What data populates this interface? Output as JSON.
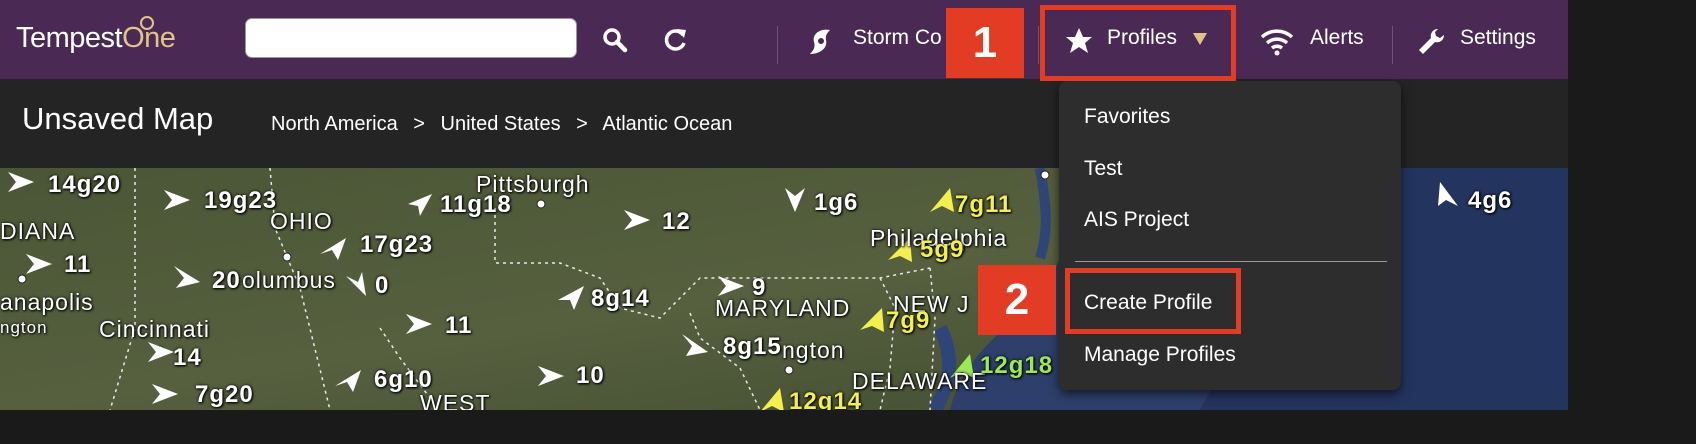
{
  "app": {
    "logo_main": "Tempest",
    "logo_accent": "One"
  },
  "search": {
    "value": "",
    "placeholder": ""
  },
  "toolbar": {
    "search_icon": "search-icon",
    "refresh_icon": "refresh-icon"
  },
  "nav": {
    "storm_label": "Storm Co",
    "profiles_label": "Profiles",
    "alerts_label": "Alerts",
    "settings_label": "Settings"
  },
  "callouts": {
    "one": "1",
    "two": "2"
  },
  "subheader": {
    "title": "Unsaved Map",
    "breadcrumb": [
      "North America",
      ">",
      "United States",
      ">",
      "Atlantic Ocean"
    ]
  },
  "profiles_menu": {
    "items": [
      "Favorites",
      "Test",
      "AIS Project"
    ],
    "actions": [
      "Create Profile",
      "Manage Profiles"
    ]
  },
  "map": {
    "wind_labels": [
      "14g20",
      "19g23",
      "11g18",
      "12",
      "1g6",
      "7g11",
      "4g6",
      "11",
      "17g23",
      "5g9",
      "20",
      "0",
      "8g14",
      "9",
      "11",
      "7g9",
      "14",
      "8g15",
      "6g10",
      "10",
      "12g18",
      "7g20",
      "12g14"
    ],
    "places": [
      "Pittsburgh",
      "OHIO",
      "DIANA",
      "olumbus",
      "anapolis",
      "ngton",
      "Cincinnati",
      "MARYLAND",
      "NEW J",
      "Philadelphia",
      "ngton",
      "DELAWARE",
      "WEST"
    ]
  },
  "colors": {
    "topbar": "#4a2a55",
    "accent": "#e2c487",
    "callout": "#e23c24",
    "menu_bg": "#2d2d2d"
  }
}
